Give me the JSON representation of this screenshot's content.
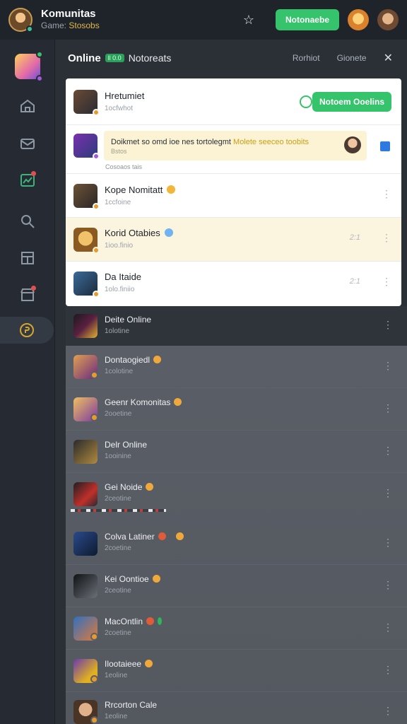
{
  "topbar": {
    "title": "Komunitas",
    "subtitle_prefix": "Game:",
    "subtitle_value": "Stosobs",
    "primary_button": "Notonaebe"
  },
  "content_header": {
    "title": "Online",
    "badge": "ll 0.0",
    "subtitle": "Notoreats",
    "action_1": "Rorhiot",
    "action_2": "Gionete"
  },
  "panel": {
    "rows": [
      {
        "name": "Hretumiet",
        "sub": "1ocfwhot",
        "button": "Notoem Ooelins"
      },
      {
        "notice_text": "Doikmet so omd ioe nes tortolegmt",
        "notice_highlight": "Molete seeceo toobits",
        "notice_sub": "Bstos",
        "footer": "Cosoaos tais"
      },
      {
        "name": "Kope Nomitatt",
        "sub": "1ccfoine"
      },
      {
        "name": "Korid Otabies",
        "sub": "1ioo.finio",
        "time": "2:1"
      },
      {
        "name": "Da Itaide",
        "sub": "1olo.finiio",
        "time": "2:1"
      }
    ]
  },
  "list": [
    {
      "name": "Deite Online",
      "sub": "1olotine"
    },
    {
      "name": "Dontaogiedl",
      "sub": "1colotine"
    },
    {
      "name": "Geenr Komonitas",
      "sub": "2ooetine"
    },
    {
      "name": "Delr Online",
      "sub": "1ooinine"
    },
    {
      "name": "Gei Noide",
      "sub": "2ceotine"
    },
    {
      "name": "Colva Latiner",
      "sub": "2coetine"
    },
    {
      "name": "Kei Oontioe",
      "sub": "2ceotine"
    },
    {
      "name": "MacOntlin",
      "sub": "2coetine"
    },
    {
      "name": "Ilootaieee",
      "sub": "1eoline"
    },
    {
      "name": "Rrcorton Cale",
      "sub": "1eoline"
    }
  ],
  "colors": {
    "accent_green": "#35c36b",
    "highlight_row": "#fbf5df"
  },
  "icons": [
    "star-icon",
    "whatsapp-icon",
    "edit-icon",
    "kebab-icon",
    "close-icon",
    "home-icon",
    "inbox-icon",
    "chart-icon",
    "search-icon",
    "grid-icon",
    "store-icon",
    "coin-icon"
  ]
}
